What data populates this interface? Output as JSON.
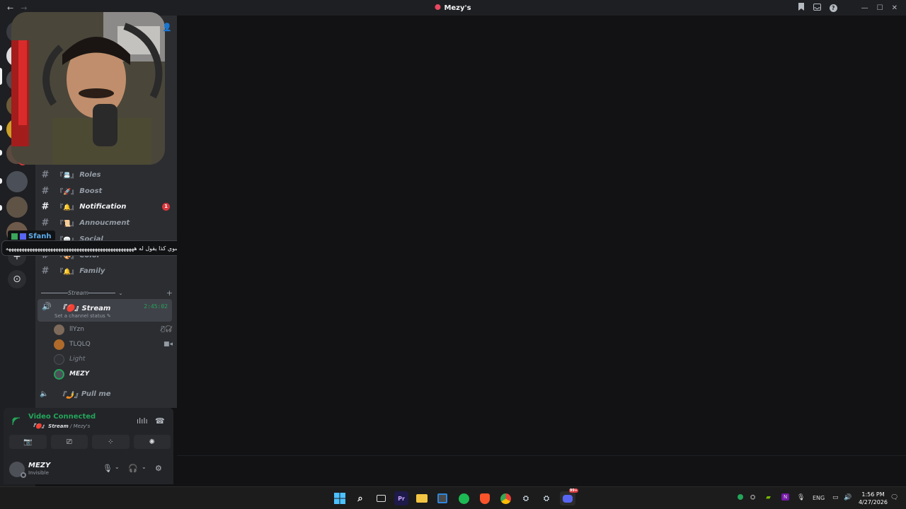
{
  "window": {
    "title": "Mezy's",
    "back_glyph": "←",
    "forward_glyph": "→",
    "controls": {
      "minimize": "—",
      "maximize": "☐",
      "close": "✕"
    },
    "toolbar_icons": [
      "bookmark-icon",
      "inbox-icon",
      "help-icon"
    ],
    "help_glyph": "?"
  },
  "rail": {
    "badge_count": "5",
    "add_glyph": "+",
    "discover_glyph": "⊙"
  },
  "channels": [
    {
      "name": "Roles",
      "deco": "『📇』",
      "unread": false
    },
    {
      "name": "Boost",
      "deco": "『🚀』",
      "unread": false
    },
    {
      "name": "Notification",
      "deco": "『🔔』",
      "unread": true,
      "badge": "1"
    },
    {
      "name": "Annoucment",
      "deco": "『📜』",
      "unread": false
    },
    {
      "name": "Social",
      "deco": "『💬』",
      "unread": false
    },
    {
      "name": "Color",
      "deco": "『🎨』",
      "unread": false
    },
    {
      "name": "Family",
      "deco": "『🔔』",
      "unread": false
    }
  ],
  "category": {
    "name": "Stream",
    "add_glyph": "+"
  },
  "voice_channel": {
    "name": "Stream",
    "deco": "『🔴』",
    "elapsed": "2:45:02",
    "status_placeholder": "Set a channel status",
    "members": [
      {
        "name": "llYzn",
        "icon": "deafened-icon"
      },
      {
        "name": "TLQLQ",
        "icon": "video-icon"
      },
      {
        "name": "Light",
        "icon": ""
      },
      {
        "name": "MEZY",
        "icon": ""
      }
    ]
  },
  "voice_channel_2": {
    "name": "Pull me",
    "deco": "『🤳』"
  },
  "tooltip": {
    "username": "Sfanh",
    "message": "نهايه يگه اس صالح كان يسوي كذا يقول له هههههههههههههههههههههههههههههههههههههههههههههههههه"
  },
  "voice_panel": {
    "status": "Video Connected",
    "channel": "『🔴』 Stream",
    "server": "Mezy's",
    "separator": " / "
  },
  "user": {
    "name": "MEZY",
    "status": "Invisible"
  },
  "taskbar": {
    "language": "ENG",
    "time": "1:56 PM",
    "date": "4/27/2026",
    "discord_badge": "99+",
    "apps": [
      "windows-start-icon",
      "search-icon",
      "task-view-icon",
      "premiere-icon",
      "file-explorer-icon",
      "store-icon",
      "spotify-icon",
      "brave-icon",
      "chrome-icon",
      "steam-icon",
      "steam-icon",
      "discord-icon"
    ]
  },
  "colors": {
    "accent_green": "#23a55a",
    "badge_red": "#da373c",
    "background": "#121214",
    "sidebar": "#2b2d31"
  }
}
